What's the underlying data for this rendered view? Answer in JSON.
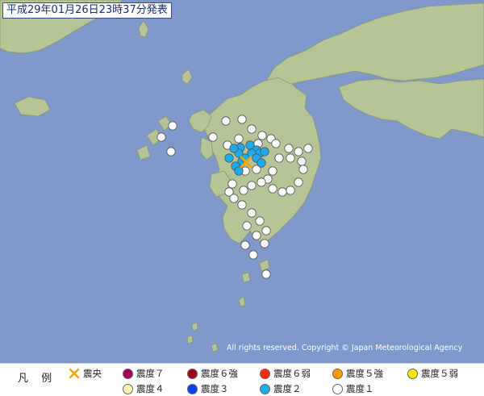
{
  "map": {
    "title": "平成29年01月26日23時37分発表",
    "copyright": "All rights reserved. Copyright © Japan Meteorological Agency",
    "colors": {
      "sea": "#7e99c9",
      "land": "#b5c596",
      "land_stroke": "#8a9a72"
    }
  },
  "legend": {
    "title": "凡 例",
    "items": [
      {
        "label": "震央",
        "kind": "epicenter",
        "color": "#f5a800"
      },
      {
        "label": "震度７",
        "kind": "dot",
        "color": "#a1005e"
      },
      {
        "label": "震度６強",
        "kind": "dot",
        "color": "#9e0a1a"
      },
      {
        "label": "震度６弱",
        "kind": "dot",
        "color": "#ff2800"
      },
      {
        "label": "震度５強",
        "kind": "dot",
        "color": "#ff9900"
      },
      {
        "label": "震度５弱",
        "kind": "dot",
        "color": "#ffe600"
      },
      {
        "label": "震度４",
        "kind": "dot",
        "color": "#fff5b3"
      },
      {
        "label": "震度３",
        "kind": "dot",
        "color": "#0041ff"
      },
      {
        "label": "震度２",
        "kind": "dot",
        "color": "#1cadf0"
      },
      {
        "label": "震度１",
        "kind": "dot",
        "color": "#ffffff"
      }
    ]
  },
  "observations": [
    {
      "intensity": "2",
      "color": "#1cadf0",
      "count": 15
    },
    {
      "intensity": "1",
      "color": "#ffffff",
      "count": 44
    }
  ]
}
